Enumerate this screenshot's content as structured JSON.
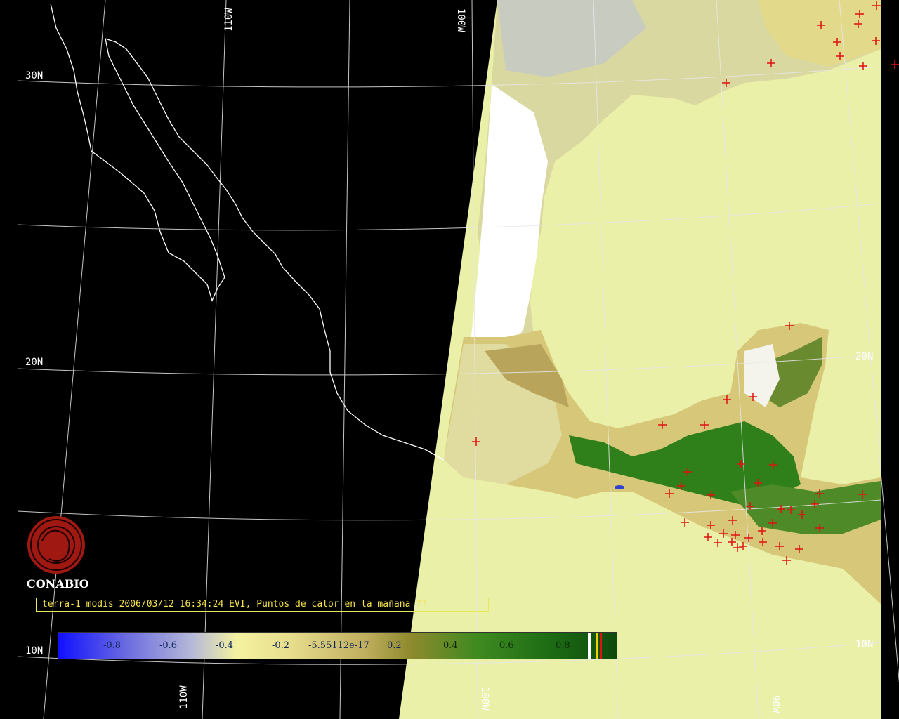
{
  "map": {
    "grid_labels": {
      "lat_30": "30N",
      "lat_20_left": "20N",
      "lat_10_left": "10N",
      "lat_20_right": "20N",
      "lat_10_right": "10N",
      "lon_110_top": "110W",
      "lon_100_top": "100W",
      "lon_110_bottom": "110W",
      "lon_100_bottom": "100W",
      "lon_90_bottom": "90W"
    },
    "colors": {
      "background": "#000000",
      "ocean_gulf": "#eaf0a8",
      "cloud": "#ffffff",
      "vegetation_dark": "#2a7a16",
      "vegetation_mid": "#a8a048",
      "coastline": "#ffffff",
      "hotspot": "#e01010"
    }
  },
  "logo": {
    "text": "CONABIO",
    "color": "#b01a14"
  },
  "caption": {
    "text": "terra-1 modis 2006/03/12 16:34:24 EVI, Puntos de calor en la mañana ??"
  },
  "colorbar": {
    "ticks": [
      "-0.8",
      "-0.6",
      "-0.4",
      "-0.2",
      "-5.55112e-17",
      "0.2",
      "0.4",
      "0.6",
      "0.8"
    ]
  }
}
